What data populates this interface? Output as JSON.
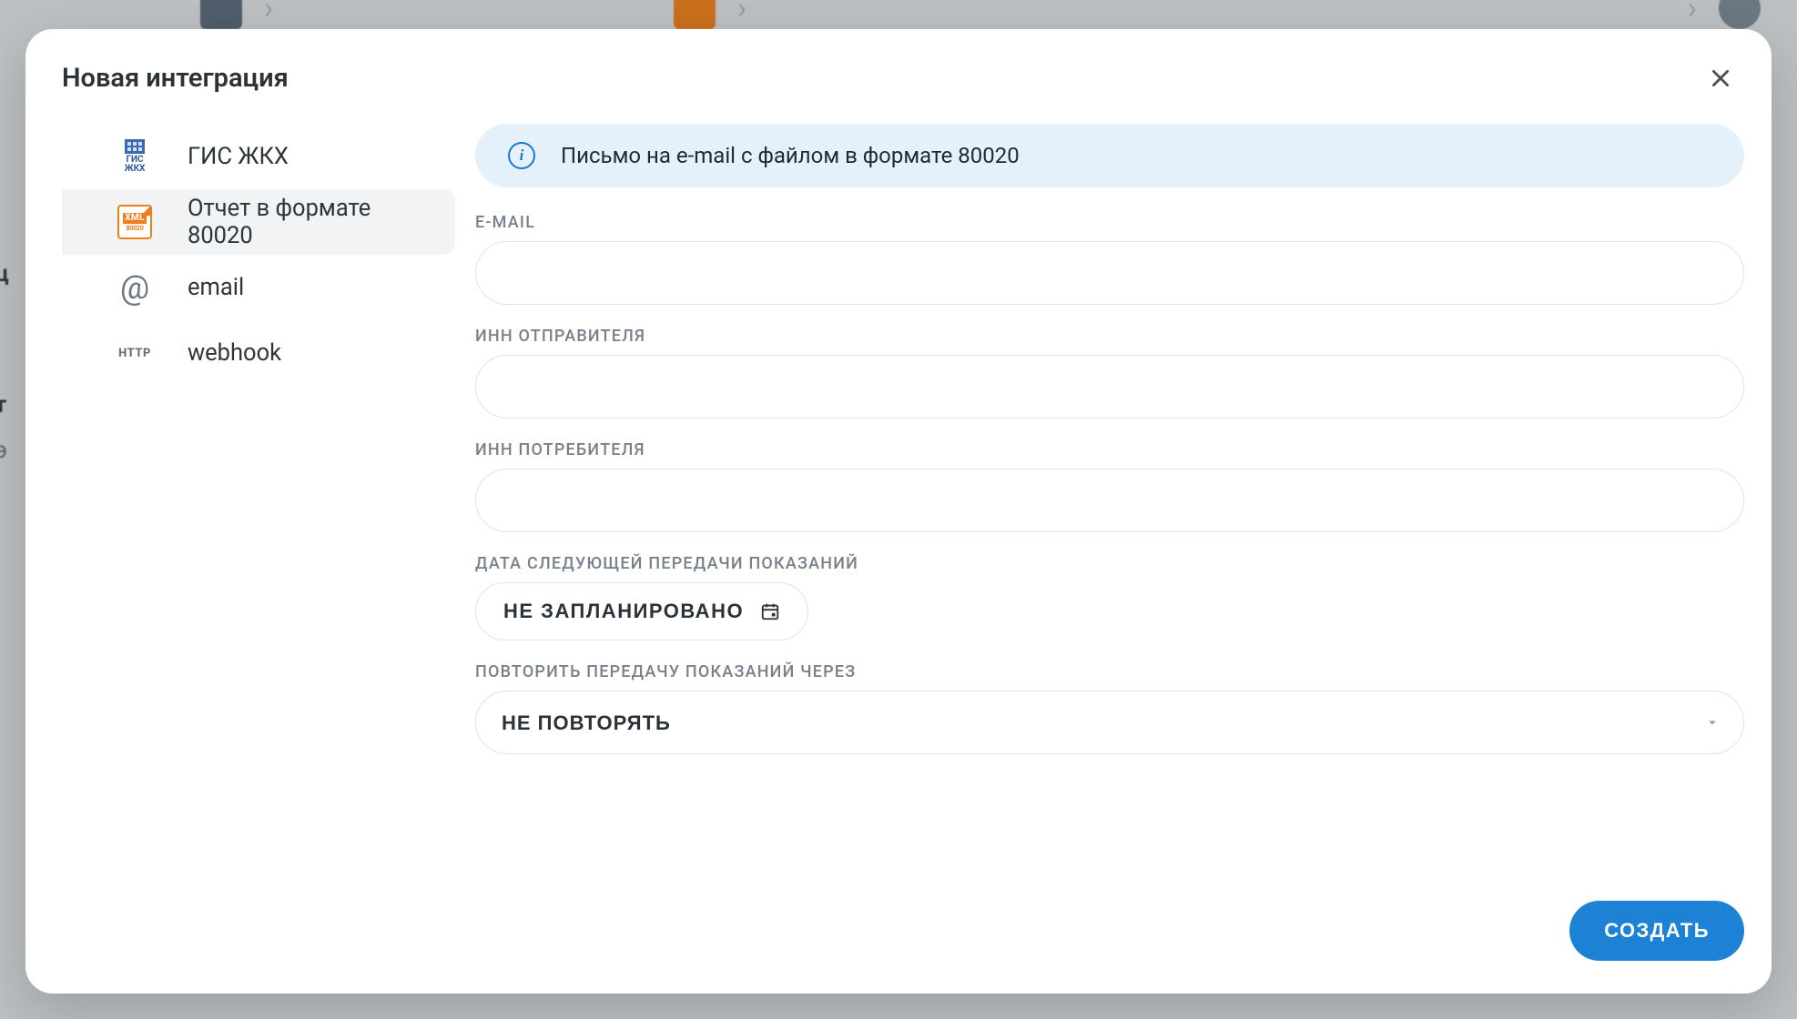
{
  "modal": {
    "title": "Новая интеграция",
    "info_banner": "Письмо на e-mail с файлом в формате 80020",
    "create_label": "СОЗДАТЬ"
  },
  "sidebar": {
    "items": [
      {
        "id": "gis",
        "label": "ГИС ЖКХ",
        "icon": "gis",
        "active": false
      },
      {
        "id": "xml80020",
        "label": "Отчет в формате 80020",
        "icon": "xml",
        "active": true
      },
      {
        "id": "email",
        "label": "email",
        "icon": "at",
        "active": false
      },
      {
        "id": "webhook",
        "label": "webhook",
        "icon": "http",
        "active": false
      }
    ]
  },
  "form": {
    "email": {
      "label": "E-MAIL",
      "value": ""
    },
    "sender_inn": {
      "label": "ИНН ОТПРАВИТЕЛЯ",
      "value": ""
    },
    "consumer_inn": {
      "label": "ИНН ПОТРЕБИТЕЛЯ",
      "value": ""
    },
    "next_date": {
      "label": "ДАТА СЛЕДУЮЩЕЙ ПЕРЕДАЧИ ПОКАЗАНИЙ",
      "value": "НЕ ЗАПЛАНИРОВАНО"
    },
    "repeat": {
      "label": "ПОВТОРИТЬ ПЕРЕДАЧУ ПОКАЗАНИЙ ЧЕРЕЗ",
      "value": "НЕ ПОВТОРЯТЬ"
    }
  },
  "icons": {
    "xml_tag": "XML",
    "xml_sub": "80020",
    "gis_text": "ГИС ЖКХ",
    "http_text": "HTTP"
  }
}
